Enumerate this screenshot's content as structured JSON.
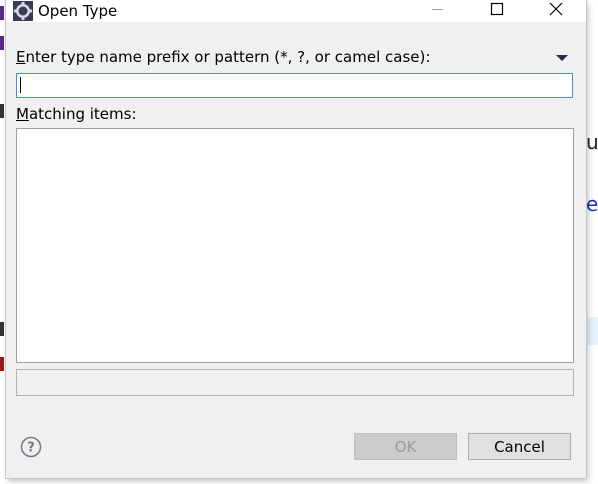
{
  "window": {
    "title": "Open Type"
  },
  "pattern": {
    "label_mnemonic": "E",
    "label_rest": "nter type name prefix or pattern (*, ?, or camel case):",
    "value": ""
  },
  "matching": {
    "label_mnemonic": "M",
    "label_rest": "atching items:",
    "items": []
  },
  "status": {
    "text": ""
  },
  "buttons": {
    "ok_label": "OK",
    "cancel_label": "Cancel"
  },
  "background_fragments": {
    "right_1": "u",
    "right_2": "e"
  },
  "icons": {
    "app": "eclipse-gear-icon",
    "minimize": "minimize-icon",
    "maximize": "maximize-icon",
    "close": "close-icon",
    "dropdown": "triangle-down-icon",
    "help": "help-icon"
  },
  "colors": {
    "dialog_bg": "#f0f0f0",
    "input_focus_border": "#4a90d9",
    "button_disabled_bg": "#cccccc",
    "button_bg": "#e1e1e1"
  }
}
